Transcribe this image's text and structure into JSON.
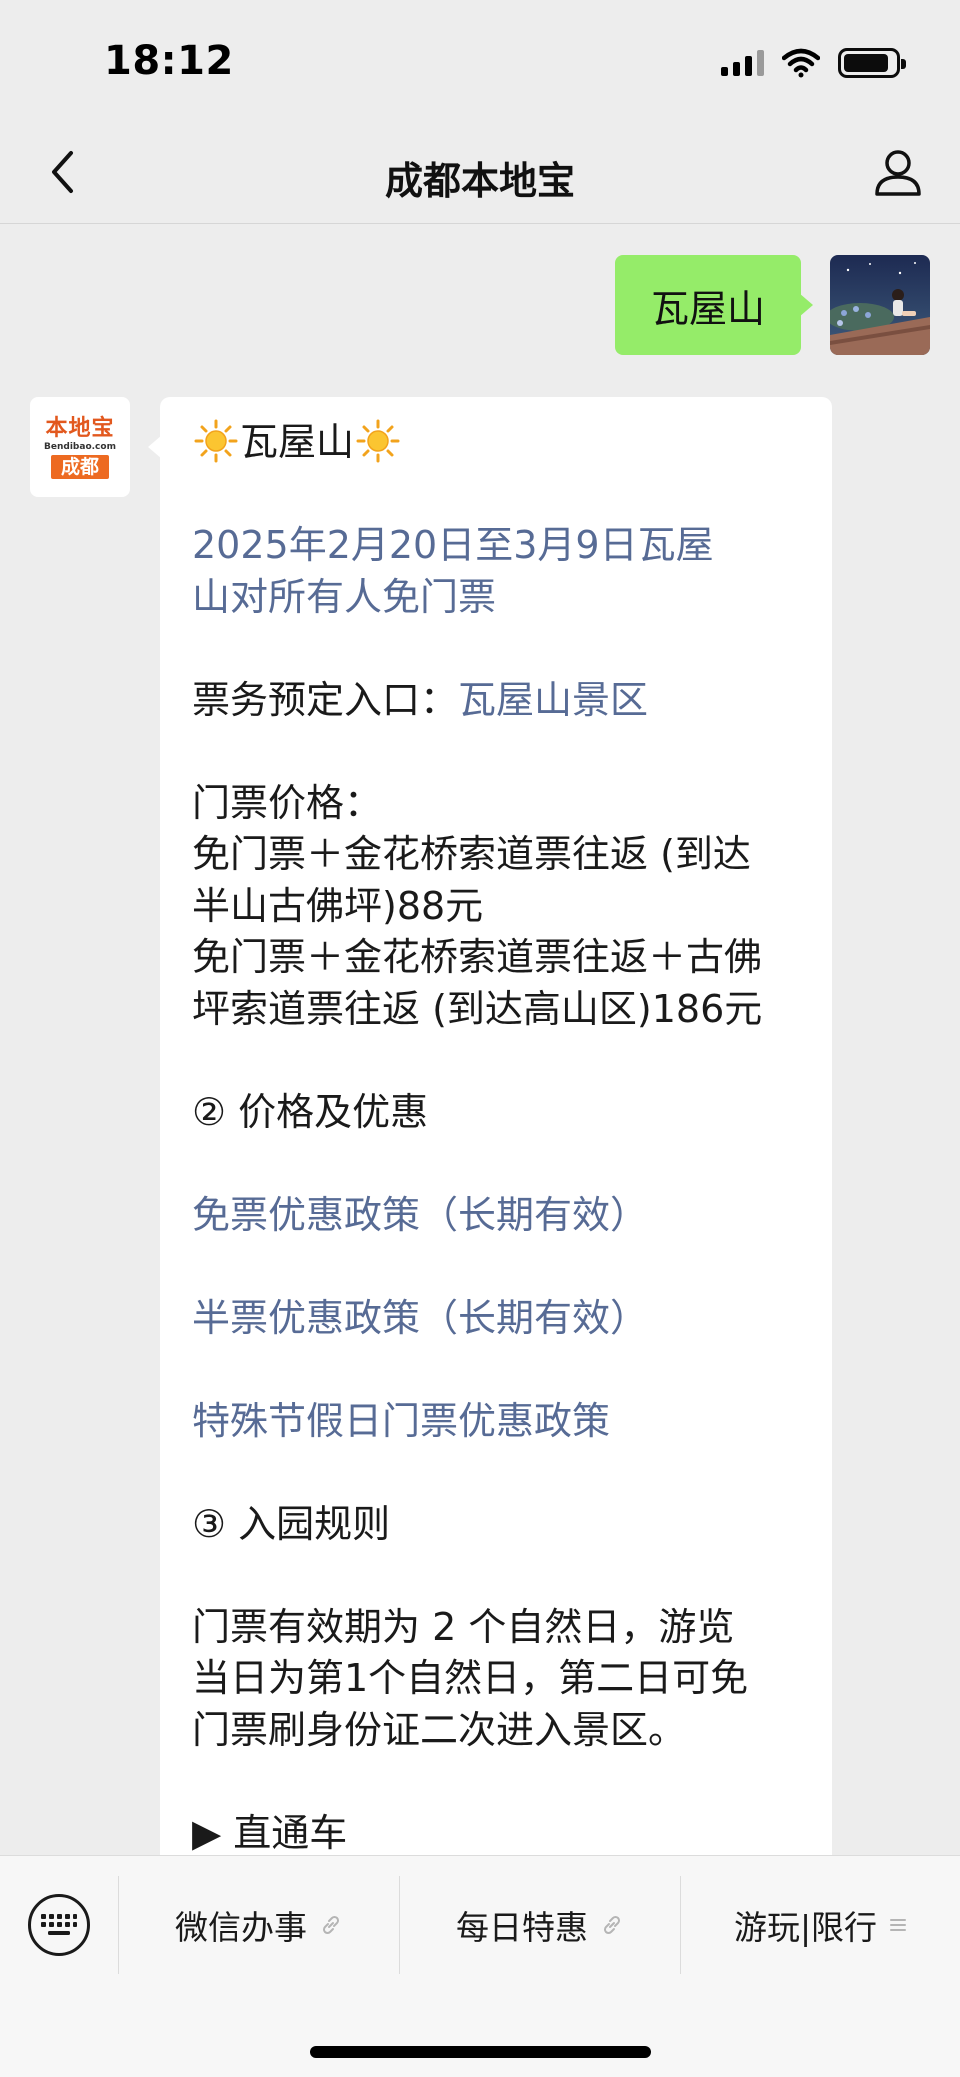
{
  "status_bar": {
    "time": "18:12",
    "battery_level": 0.88
  },
  "nav": {
    "title": "成都本地宝"
  },
  "messages": {
    "user": {
      "text": "瓦屋山"
    },
    "bot": {
      "avatar": {
        "logo_top": "本地宝",
        "logo_site": "Bendibao.com",
        "logo_city": "成都"
      },
      "title": "瓦屋山",
      "headline": [
        "2025年2月20日至3月9日瓦屋",
        "山对所有人免门票"
      ],
      "booking_label": "票务预定入口：",
      "booking_link": "瓦屋山景区",
      "price_heading": "门票价格：",
      "price_lines": [
        "免门票＋金花桥索道票往返 (到达",
        "半山古佛坪)88元",
        "免门票＋金花桥索道票往返＋古佛",
        "坪索道票往返 (到达高山区)186元"
      ],
      "section2_heading": "② 价格及优惠",
      "policy_links": [
        "免票优惠政策（长期有效）",
        "半票优惠政策（长期有效）",
        "特殊节假日门票优惠政策"
      ],
      "section3_heading": "③ 入园规则",
      "rule_lines": [
        "门票有效期为 2 个自然日，游览",
        "当日为第1个自然日，第二日可免",
        "门票刷身份证二次进入景区。"
      ],
      "next_heading": "▶ 直通车"
    }
  },
  "bottom_menu": {
    "items": [
      {
        "label": "微信办事",
        "icon": "link-icon"
      },
      {
        "label": "每日特惠",
        "icon": "link-icon"
      },
      {
        "label": "游玩|限行",
        "icon": "menu-icon"
      }
    ]
  },
  "colors": {
    "link": "#576b95",
    "user_bubble": "#95ec69",
    "logo_orange": "#ed6a21"
  }
}
